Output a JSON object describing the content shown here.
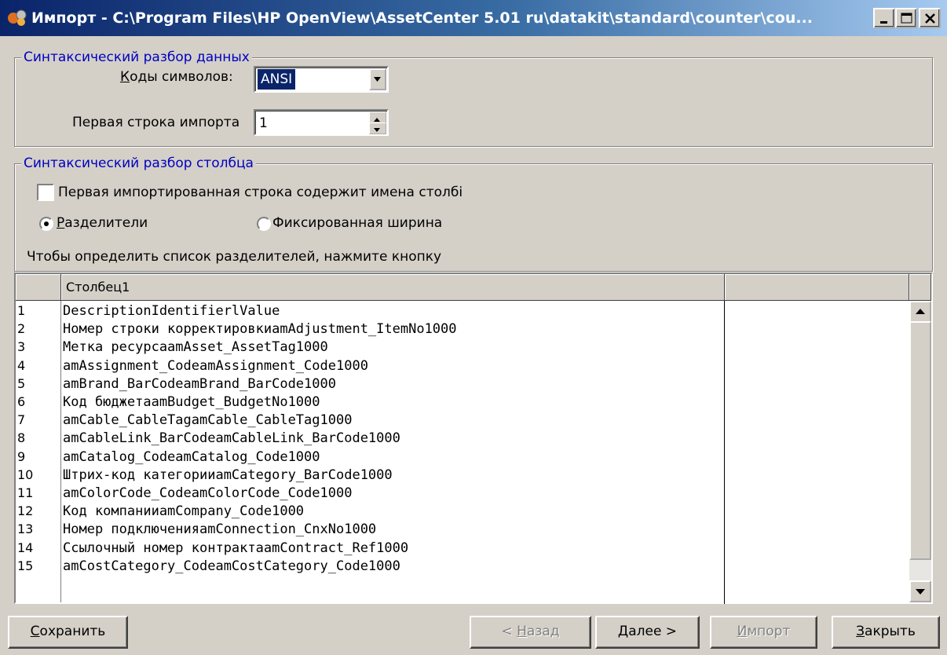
{
  "window": {
    "title": "Импорт - C:\\Program Files\\HP OpenView\\AssetCenter 5.01 ru\\datakit\\standard\\counter\\cou...",
    "icon": "import-app-icon"
  },
  "data_parse": {
    "legend": "Синтаксический разбор данных",
    "charset_label": "Коды символов:",
    "charset_value": "ANSI",
    "first_row_label": "Первая строка импорта",
    "first_row_value": "1"
  },
  "column_parse": {
    "legend": "Синтаксический разбор столбца",
    "header_checkbox_label": "Первая импортированная строка содержит имена столбі",
    "header_checkbox_checked": false,
    "radio_separators_label": "Разделители",
    "radio_separators_checked": true,
    "radio_fixed_label": "Фиксированная ширина",
    "radio_fixed_checked": false,
    "hint": "Чтобы определить список разделителей, нажмите кнопку"
  },
  "grid": {
    "column_header": "Столбец1",
    "rows": [
      {
        "n": "1",
        "text": "DescriptionIdentifierlValue"
      },
      {
        "n": "2",
        "text": "Номер строки корректировкиamAdjustment_ItemNo1000"
      },
      {
        "n": "3",
        "text": "Метка ресурсаamAsset_AssetTag1000"
      },
      {
        "n": "4",
        "text": "amAssignment_CodeamAssignment_Code1000"
      },
      {
        "n": "5",
        "text": "amBrand_BarCodeamBrand_BarCode1000"
      },
      {
        "n": "6",
        "text": "Код бюджетаamBudget_BudgetNo1000"
      },
      {
        "n": "7",
        "text": "amCable_CableTagamCable_CableTag1000"
      },
      {
        "n": "8",
        "text": "amCableLink_BarCodeamCableLink_BarCode1000"
      },
      {
        "n": "9",
        "text": "amCatalog_CodeamCatalog_Code1000"
      },
      {
        "n": "10",
        "text": "Штрих-код категорииamCategory_BarCode1000"
      },
      {
        "n": "11",
        "text": "amColorCode_CodeamColorCode_Code1000"
      },
      {
        "n": "12",
        "text": "Код компанииamCompany_Code1000"
      },
      {
        "n": "13",
        "text": "Номер подключенияamConnection_CnxNo1000"
      },
      {
        "n": "14",
        "text": "Ссылочный номер контрактаamContract_Ref1000"
      },
      {
        "n": "15",
        "text": "amCostCategory_CodeamCostCategory_Code1000"
      }
    ]
  },
  "buttons": {
    "save": "Сохранить",
    "back": "< Назад",
    "next": "Далее >",
    "import": "Импорт",
    "close": "Закрыть"
  }
}
